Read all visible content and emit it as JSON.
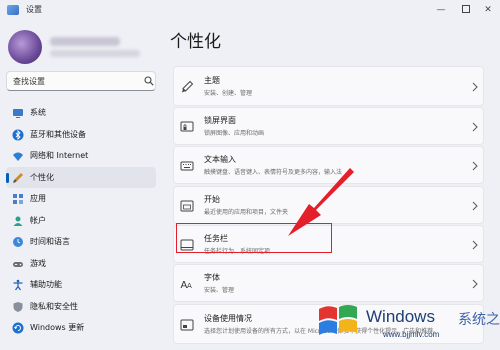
{
  "window": {
    "title": "设置"
  },
  "search": {
    "value": "查找设置"
  },
  "sidebar": {
    "items": [
      {
        "label": "系统",
        "icon": "monitor-icon"
      },
      {
        "label": "蓝牙和其他设备",
        "icon": "bluetooth-icon"
      },
      {
        "label": "网络和 Internet",
        "icon": "wifi-icon"
      },
      {
        "label": "个性化",
        "icon": "brush-icon",
        "active": true
      },
      {
        "label": "应用",
        "icon": "apps-icon"
      },
      {
        "label": "帐户",
        "icon": "account-icon"
      },
      {
        "label": "时间和语言",
        "icon": "globe-clock-icon"
      },
      {
        "label": "游戏",
        "icon": "gamepad-icon"
      },
      {
        "label": "辅助功能",
        "icon": "accessibility-icon"
      },
      {
        "label": "隐私和安全性",
        "icon": "shield-icon"
      },
      {
        "label": "Windows 更新",
        "icon": "update-icon"
      }
    ]
  },
  "main": {
    "title": "个性化",
    "cards": [
      {
        "title": "主题",
        "subtitle": "安装、创建、管理",
        "icon": "brush-icon"
      },
      {
        "title": "锁屏界面",
        "subtitle": "锁屏图像、应用和动画",
        "icon": "lock-screen-icon"
      },
      {
        "title": "文本输入",
        "subtitle": "触摸键盘、语音键入、表情符号及更多内容，输入法",
        "icon": "keyboard-icon"
      },
      {
        "title": "开始",
        "subtitle": "最近使用的应用和项目，文件夹",
        "icon": "start-icon"
      },
      {
        "title": "任务栏",
        "subtitle": "任务栏行为、系统固定项",
        "icon": "taskbar-icon"
      },
      {
        "title": "字体",
        "subtitle": "安装、管理",
        "icon": "font-icon"
      },
      {
        "title": "设备使用情况",
        "subtitle": "选择您计划使用设备的所有方式，以在 Microsoft 体验中获得个性化提示、广告和推荐。",
        "icon": "device-usage-icon"
      }
    ]
  },
  "watermark": {
    "brand": "Windows",
    "cn": "系统之家",
    "url": "www.bjjmlv.com"
  },
  "colors": {
    "accent": "#005fb8",
    "arrow": "#e41e2b",
    "background": "#eef0f6",
    "card": "#f9f9fb"
  }
}
